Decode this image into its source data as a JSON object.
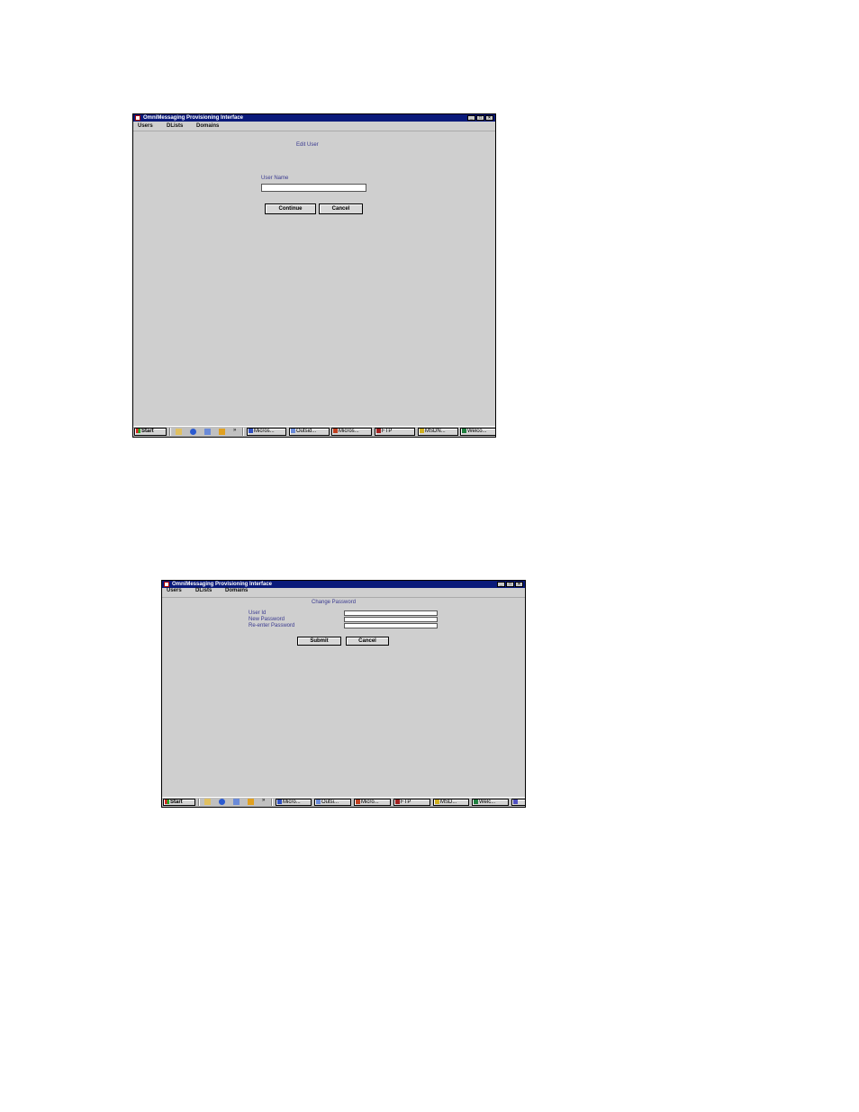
{
  "screenshots": [
    {
      "window_title": "OmniMessaging Provisioning Interface",
      "menu": [
        "Users",
        "DLists",
        "Domains"
      ],
      "form": {
        "heading": "Edit User",
        "fields": [
          {
            "label": "User Name",
            "value": ""
          }
        ],
        "buttons": [
          "Continue",
          "Cancel"
        ]
      },
      "taskbar": {
        "start": "Start",
        "quicklaunch_icons": [
          "desktop-icon",
          "internet-explorer-icon",
          "outlook-icon",
          "media-player-icon"
        ],
        "chevron": "»",
        "items": [
          "Micros...",
          "Outsid...",
          "Micros...",
          "FTP",
          "MSDN...",
          "Welco..."
        ]
      }
    },
    {
      "window_title": "OmniMessaging Provisioning Interface",
      "menu": [
        "Users",
        "DLists",
        "Domains"
      ],
      "form": {
        "heading": "Change Password",
        "fields": [
          {
            "label": "User Id",
            "value": ""
          },
          {
            "label": "New Password",
            "value": ""
          },
          {
            "label": "Re-enter Password",
            "value": ""
          }
        ],
        "buttons": [
          "Submit",
          "Cancel"
        ]
      },
      "taskbar": {
        "start": "Start",
        "quicklaunch_icons": [
          "desktop-icon",
          "internet-explorer-icon",
          "outlook-icon",
          "media-player-icon"
        ],
        "chevron": "»",
        "items": [
          "Micro...",
          "Outsi...",
          "Micro...",
          "FTP",
          "MSD...",
          "Welc..."
        ]
      }
    }
  ],
  "colors": {
    "titlebar": "#0a1a7a",
    "window_bg": "#cfcfcf",
    "label_text": "#3a3a90"
  }
}
